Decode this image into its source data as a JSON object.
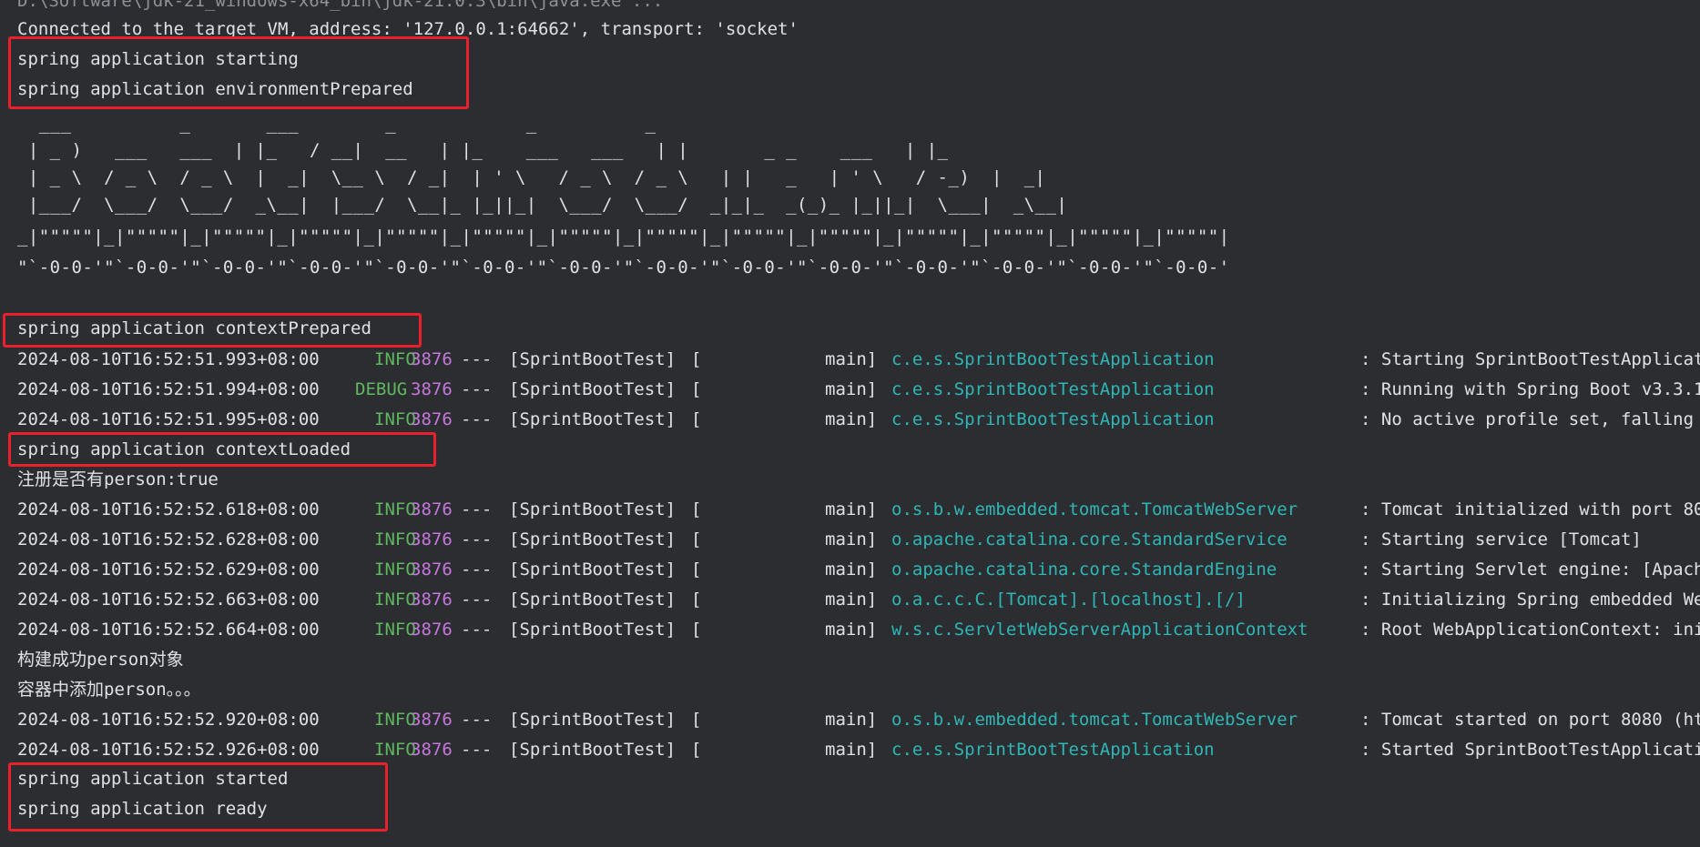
{
  "console": {
    "path_line": "D:\\Software\\jdk-21_windows-x64_bin\\jdk-21.0.3\\bin\\java.exe ...",
    "connected_line": "Connected to the target VM, address: '127.0.0.1:64662', transport: 'socket'",
    "starting": "spring application starting",
    "env_prepared": "spring application environmentPrepared",
    "banner": [
      "  ___          _       ___        _            _          _         ",
      " | _ )   ___   ___  | |_   / __|  __   | |_    ___   ___   | |       _ _    ___   | |_  ",
      " | _ \\  / _ \\  / _ \\  |  _|  \\__ \\  / _|  | ' \\   / _ \\  / _ \\   | |   _   | ' \\   / -_)  |  _| ",
      " |___/  \\___/  \\___/  _\\__|  |___/  \\__|_ |_||_|  \\___/  \\___/  _|_|_  _(_)_ |_||_|  \\___|  _\\__| ",
      "_|\"\"\"\"\"|_|\"\"\"\"\"|_|\"\"\"\"\"|_|\"\"\"\"\"|_|\"\"\"\"\"|_|\"\"\"\"\"|_|\"\"\"\"\"|_|\"\"\"\"\"|_|\"\"\"\"\"|_|\"\"\"\"\"|_|\"\"\"\"\"|_|\"\"\"\"\"|_|\"\"\"\"\"|_|\"\"\"\"\"|",
      "\"`-0-0-'\"`-0-0-'\"`-0-0-'\"`-0-0-'\"`-0-0-'\"`-0-0-'\"`-0-0-'\"`-0-0-'\"`-0-0-'\"`-0-0-'\"`-0-0-'\"`-0-0-'\"`-0-0-'\"`-0-0-'"
    ],
    "context_prepared": "spring application contextPrepared",
    "context_loaded": "spring application contextLoaded",
    "registered_person": "注册是否有person:true",
    "built_person": "构建成功person对象",
    "added_person": "容器中添加person。。。",
    "started": "spring application started",
    "ready": "spring application ready",
    "log_group_1": [
      {
        "ts": "2024-08-10T16:52:51.993+08:00",
        "level": "INFO",
        "pid": "3876",
        "sep": "---",
        "app": "[SprintBootTest]",
        "bracket": "[",
        "thread": "main]",
        "logger": "c.e.s.SprintBootTestApplication",
        "msg": ": Starting SprintBootTestApplicat"
      },
      {
        "ts": "2024-08-10T16:52:51.994+08:00",
        "level": "DEBUG",
        "pid": "3876",
        "sep": "---",
        "app": "[SprintBootTest]",
        "bracket": "[",
        "thread": "main]",
        "logger": "c.e.s.SprintBootTestApplication",
        "msg": ": Running with Spring Boot v3.3.1"
      },
      {
        "ts": "2024-08-10T16:52:51.995+08:00",
        "level": "INFO",
        "pid": "3876",
        "sep": "---",
        "app": "[SprintBootTest]",
        "bracket": "[",
        "thread": "main]",
        "logger": "c.e.s.SprintBootTestApplication",
        "msg": ": No active profile set, falling"
      }
    ],
    "log_group_2": [
      {
        "ts": "2024-08-10T16:52:52.618+08:00",
        "level": "INFO",
        "pid": "3876",
        "sep": "---",
        "app": "[SprintBootTest]",
        "bracket": "[",
        "thread": "main]",
        "logger": "o.s.b.w.embedded.tomcat.TomcatWebServer",
        "msg": ": Tomcat initialized with port 80"
      },
      {
        "ts": "2024-08-10T16:52:52.628+08:00",
        "level": "INFO",
        "pid": "3876",
        "sep": "---",
        "app": "[SprintBootTest]",
        "bracket": "[",
        "thread": "main]",
        "logger": "o.apache.catalina.core.StandardService",
        "msg": ": Starting service [Tomcat]"
      },
      {
        "ts": "2024-08-10T16:52:52.629+08:00",
        "level": "INFO",
        "pid": "3876",
        "sep": "---",
        "app": "[SprintBootTest]",
        "bracket": "[",
        "thread": "main]",
        "logger": "o.apache.catalina.core.StandardEngine",
        "msg": ": Starting Servlet engine: [Apach"
      },
      {
        "ts": "2024-08-10T16:52:52.663+08:00",
        "level": "INFO",
        "pid": "3876",
        "sep": "---",
        "app": "[SprintBootTest]",
        "bracket": "[",
        "thread": "main]",
        "logger": "o.a.c.c.C.[Tomcat].[localhost].[/]",
        "msg": ": Initializing Spring embedded We"
      },
      {
        "ts": "2024-08-10T16:52:52.664+08:00",
        "level": "INFO",
        "pid": "3876",
        "sep": "---",
        "app": "[SprintBootTest]",
        "bracket": "[",
        "thread": "main]",
        "logger": "w.s.c.ServletWebServerApplicationContext",
        "msg": ": Root WebApplicationContext: ini"
      }
    ],
    "log_group_3": [
      {
        "ts": "2024-08-10T16:52:52.920+08:00",
        "level": "INFO",
        "pid": "3876",
        "sep": "---",
        "app": "[SprintBootTest]",
        "bracket": "[",
        "thread": "main]",
        "logger": "o.s.b.w.embedded.tomcat.TomcatWebServer",
        "msg": ": Tomcat started on port 8080 (ht"
      },
      {
        "ts": "2024-08-10T16:52:52.926+08:00",
        "level": "INFO",
        "pid": "3876",
        "sep": "---",
        "app": "[SprintBootTest]",
        "bracket": "[",
        "thread": "main]",
        "logger": "c.e.s.SprintBootTestApplication",
        "msg": ": Started SprintBootTestApplicati"
      }
    ],
    "colors": {
      "background": "#2b2d30",
      "text": "#dfe1e5",
      "info": "#5fb85f",
      "pid": "#c677dd",
      "logger": "#2fb6b6",
      "highlight": "#e8212c"
    }
  }
}
